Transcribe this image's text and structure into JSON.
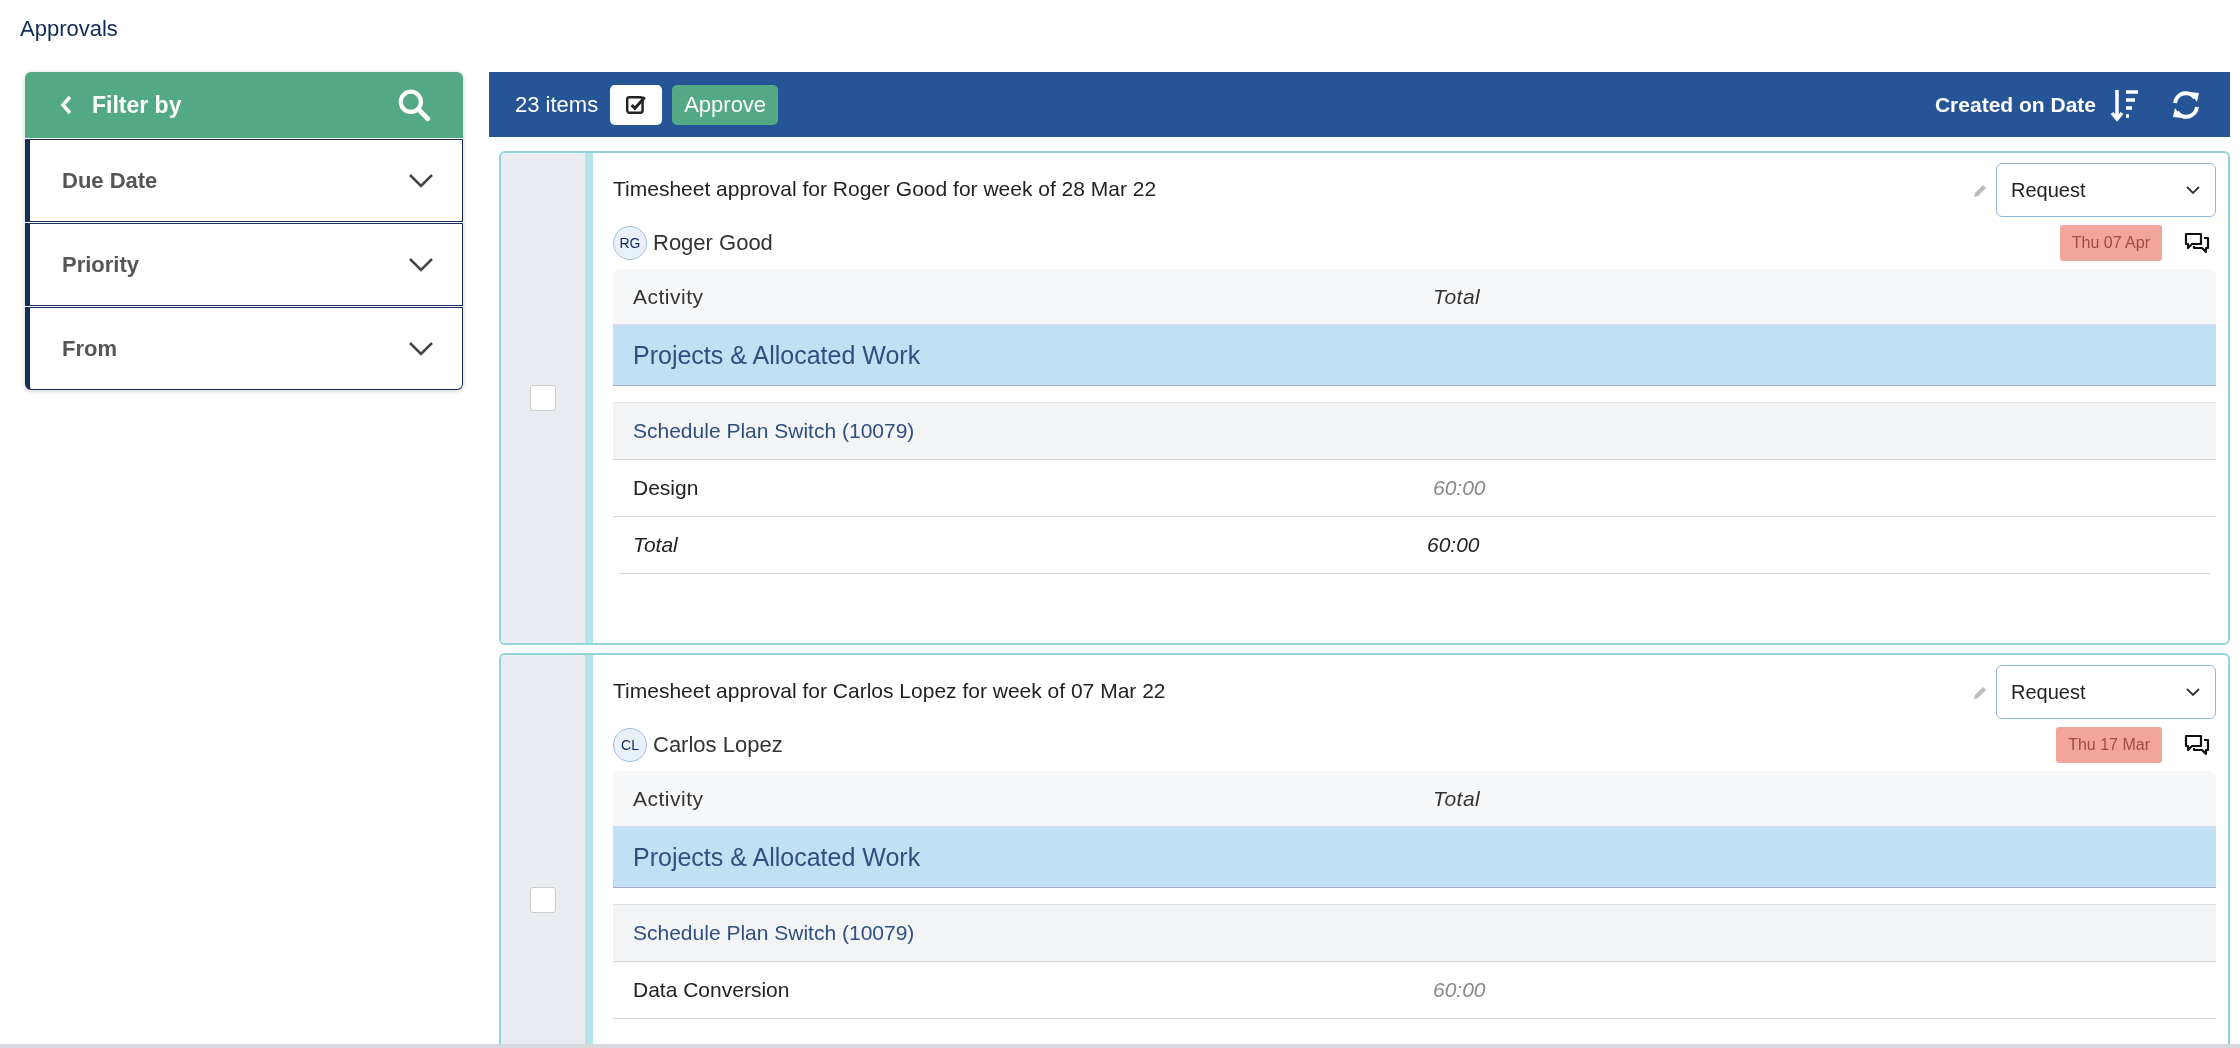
{
  "page_title": "Approvals",
  "filter": {
    "title": "Filter by",
    "sections": [
      {
        "label": "Due Date",
        "expanded": false
      },
      {
        "label": "Priority",
        "expanded": false
      },
      {
        "label": "From",
        "expanded": false
      }
    ]
  },
  "toolbar": {
    "count": "23 items",
    "approve_label": "Approve",
    "sort_label": "Created on Date"
  },
  "cards": [
    {
      "title": "Timesheet approval for Roger Good for week of 28 Mar 22",
      "initials": "RG",
      "person": "Roger Good",
      "due": "Thu 07 Apr",
      "action": "Request",
      "checked": false,
      "columns": [
        "Activity",
        "Total"
      ],
      "rows": [
        {
          "kind": "group",
          "label": "Projects & Allocated Work"
        },
        {
          "kind": "project",
          "label": "Schedule Plan Switch (10079)"
        },
        {
          "kind": "item",
          "label": "Design",
          "value": "60:00"
        },
        {
          "kind": "total",
          "label": "Total",
          "value": "60:00"
        }
      ]
    },
    {
      "title": "Timesheet approval for Carlos Lopez for week of 07 Mar 22",
      "initials": "CL",
      "person": "Carlos Lopez",
      "due": "Thu 17 Mar",
      "action": "Request",
      "checked": false,
      "columns": [
        "Activity",
        "Total"
      ],
      "rows": [
        {
          "kind": "group",
          "label": "Projects & Allocated Work"
        },
        {
          "kind": "project",
          "label": "Schedule Plan Switch (10079)"
        },
        {
          "kind": "item",
          "label": "Data Conversion",
          "value": "60:00"
        }
      ]
    }
  ]
}
